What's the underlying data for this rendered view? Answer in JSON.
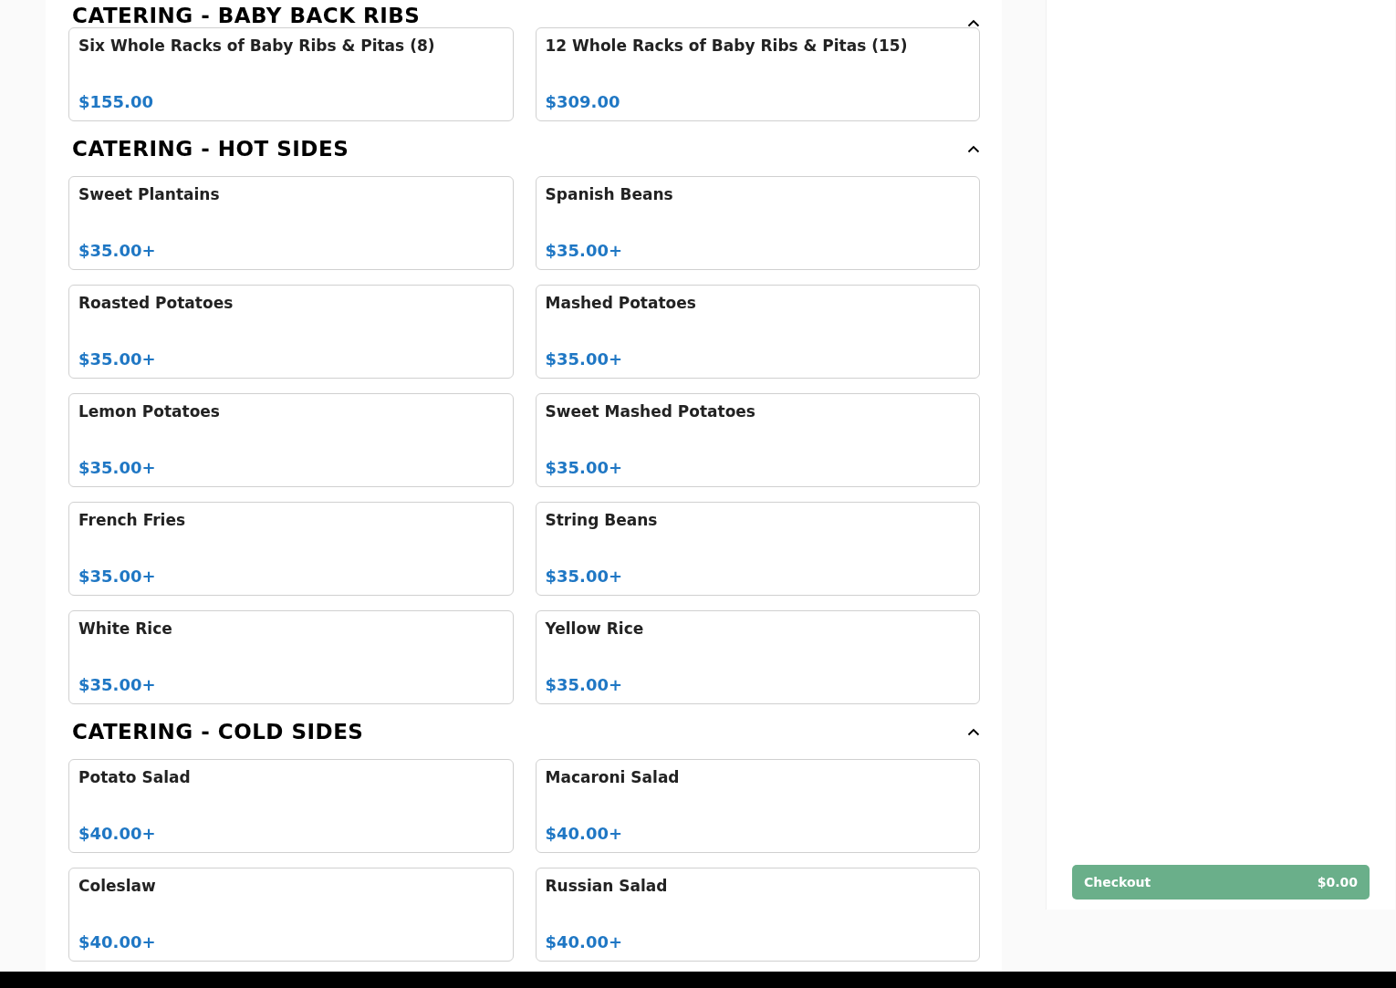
{
  "sections": [
    {
      "title": "CATERING - BABY BACK RIBS",
      "expanded": true,
      "items": [
        {
          "name": "Six Whole Racks of Baby Ribs & Pitas (8)",
          "price": "$155.00"
        },
        {
          "name": "12 Whole Racks of Baby Ribs & Pitas (15)",
          "price": "$309.00"
        }
      ]
    },
    {
      "title": "CATERING - HOT SIDES",
      "expanded": true,
      "items": [
        {
          "name": "Sweet Plantains",
          "price": "$35.00+"
        },
        {
          "name": "Spanish Beans",
          "price": "$35.00+"
        },
        {
          "name": "Roasted Potatoes",
          "price": "$35.00+"
        },
        {
          "name": "Mashed Potatoes",
          "price": "$35.00+"
        },
        {
          "name": "Lemon Potatoes",
          "price": "$35.00+"
        },
        {
          "name": "Sweet Mashed Potatoes",
          "price": "$35.00+"
        },
        {
          "name": "French Fries",
          "price": "$35.00+"
        },
        {
          "name": "String Beans",
          "price": "$35.00+"
        },
        {
          "name": "White Rice",
          "price": "$35.00+"
        },
        {
          "name": "Yellow Rice",
          "price": "$35.00+"
        }
      ]
    },
    {
      "title": "CATERING - COLD SIDES",
      "expanded": true,
      "items": [
        {
          "name": "Potato Salad",
          "price": "$40.00+"
        },
        {
          "name": "Macaroni Salad",
          "price": "$40.00+"
        },
        {
          "name": "Coleslaw",
          "price": "$40.00+"
        },
        {
          "name": "Russian Salad",
          "price": "$40.00+"
        }
      ]
    }
  ],
  "checkout": {
    "label": "Checkout",
    "total": "$0.00"
  }
}
